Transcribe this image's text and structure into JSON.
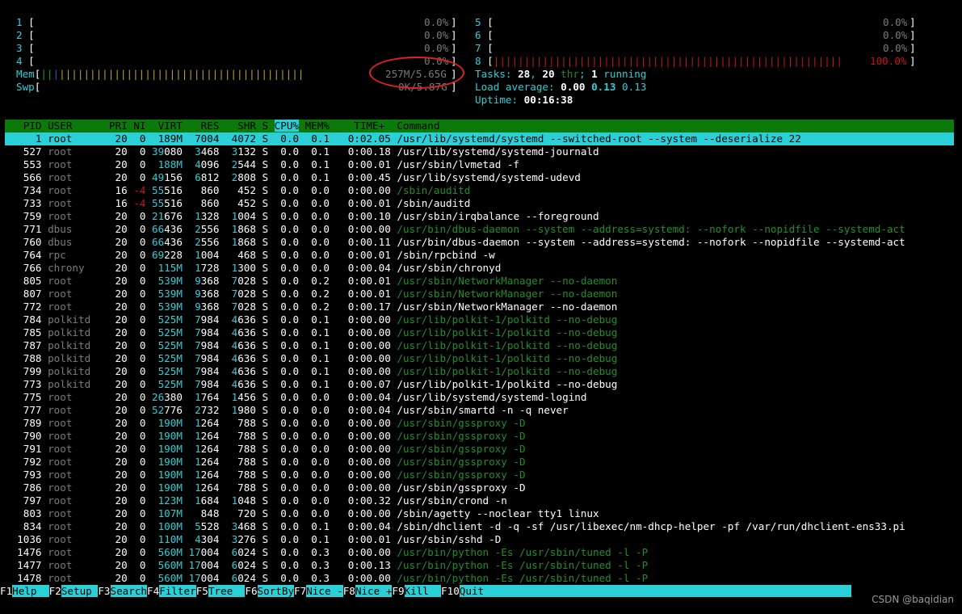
{
  "cpu_left": [
    {
      "num": "1",
      "pct": "0.0%"
    },
    {
      "num": "2",
      "pct": "0.0%"
    },
    {
      "num": "3",
      "pct": "0.0%"
    },
    {
      "num": "4",
      "pct": "0.0%"
    }
  ],
  "cpu_right": [
    {
      "num": "5",
      "pct": "0.0%"
    },
    {
      "num": "6",
      "pct": "0.0%"
    },
    {
      "num": "7",
      "pct": "0.0%"
    },
    {
      "num": "8",
      "pct": "100.0%"
    }
  ],
  "mem": {
    "label": "Mem",
    "value": "257M/5.65G"
  },
  "swp": {
    "label": "Swp",
    "value": "0K/5.87G"
  },
  "tasks": {
    "label": "Tasks: ",
    "tasks": "28",
    "sep": ", ",
    "threads": "20",
    "thr": " thr",
    "sep2": "; ",
    "running": "1",
    "running_label": " running"
  },
  "load": {
    "label": "Load average: ",
    "l1": "0.00",
    "l5": "0.13",
    "l15": "0.13"
  },
  "uptime": {
    "label": "Uptime: ",
    "value": "00:16:38"
  },
  "columns": [
    "PID",
    "USER",
    "PRI",
    "NI",
    "VIRT",
    "RES",
    "SHR",
    "S",
    "CPU%",
    "MEM%",
    "TIME+",
    "Command"
  ],
  "processes": [
    {
      "pid": "1",
      "user": "root",
      "pri": "20",
      "ni": "0",
      "virt": "189M",
      "res": "7004",
      "shr": "4072",
      "s": "S",
      "cpu": "0.0",
      "mem": "0.1",
      "time": "0:02.05",
      "cmd": "/usr/lib/systemd/systemd --switched-root --system --deserialize 22",
      "thread": false,
      "selected": true
    },
    {
      "pid": "527",
      "user": "root",
      "pri": "20",
      "ni": "0",
      "virt": "39080",
      "res": "3468",
      "shr": "3132",
      "s": "S",
      "cpu": "0.0",
      "mem": "0.1",
      "time": "0:00.18",
      "cmd": "/usr/lib/systemd/systemd-journald",
      "thread": false
    },
    {
      "pid": "553",
      "user": "root",
      "pri": "20",
      "ni": "0",
      "virt": "188M",
      "res": "4096",
      "shr": "2544",
      "s": "S",
      "cpu": "0.0",
      "mem": "0.1",
      "time": "0:00.01",
      "cmd": "/usr/sbin/lvmetad -f",
      "thread": false
    },
    {
      "pid": "566",
      "user": "root",
      "pri": "20",
      "ni": "0",
      "virt": "49156",
      "res": "6812",
      "shr": "2808",
      "s": "S",
      "cpu": "0.0",
      "mem": "0.1",
      "time": "0:00.45",
      "cmd": "/usr/lib/systemd/systemd-udevd",
      "thread": false
    },
    {
      "pid": "734",
      "user": "root",
      "pri": "16",
      "ni": "-4",
      "virt": "55516",
      "res": "860",
      "shr": "452",
      "s": "S",
      "cpu": "0.0",
      "mem": "0.0",
      "time": "0:00.00",
      "cmd": "/sbin/auditd",
      "thread": true
    },
    {
      "pid": "733",
      "user": "root",
      "pri": "16",
      "ni": "-4",
      "virt": "55516",
      "res": "860",
      "shr": "452",
      "s": "S",
      "cpu": "0.0",
      "mem": "0.0",
      "time": "0:00.01",
      "cmd": "/sbin/auditd",
      "thread": false
    },
    {
      "pid": "759",
      "user": "root",
      "pri": "20",
      "ni": "0",
      "virt": "21676",
      "res": "1328",
      "shr": "1004",
      "s": "S",
      "cpu": "0.0",
      "mem": "0.0",
      "time": "0:00.10",
      "cmd": "/usr/sbin/irqbalance --foreground",
      "thread": false
    },
    {
      "pid": "771",
      "user": "dbus",
      "pri": "20",
      "ni": "0",
      "virt": "66436",
      "res": "2556",
      "shr": "1868",
      "s": "S",
      "cpu": "0.0",
      "mem": "0.0",
      "time": "0:00.00",
      "cmd": "/usr/bin/dbus-daemon --system --address=systemd: --nofork --nopidfile --systemd-act",
      "thread": true
    },
    {
      "pid": "760",
      "user": "dbus",
      "pri": "20",
      "ni": "0",
      "virt": "66436",
      "res": "2556",
      "shr": "1868",
      "s": "S",
      "cpu": "0.0",
      "mem": "0.0",
      "time": "0:00.11",
      "cmd": "/usr/bin/dbus-daemon --system --address=systemd: --nofork --nopidfile --systemd-act",
      "thread": false
    },
    {
      "pid": "764",
      "user": "rpc",
      "pri": "20",
      "ni": "0",
      "virt": "69228",
      "res": "1004",
      "shr": "468",
      "s": "S",
      "cpu": "0.0",
      "mem": "0.0",
      "time": "0:00.01",
      "cmd": "/sbin/rpcbind -w",
      "thread": false
    },
    {
      "pid": "766",
      "user": "chrony",
      "pri": "20",
      "ni": "0",
      "virt": "115M",
      "res": "1728",
      "shr": "1300",
      "s": "S",
      "cpu": "0.0",
      "mem": "0.0",
      "time": "0:00.04",
      "cmd": "/usr/sbin/chronyd",
      "thread": false
    },
    {
      "pid": "805",
      "user": "root",
      "pri": "20",
      "ni": "0",
      "virt": "539M",
      "res": "9368",
      "shr": "7028",
      "s": "S",
      "cpu": "0.0",
      "mem": "0.2",
      "time": "0:00.01",
      "cmd": "/usr/sbin/NetworkManager --no-daemon",
      "thread": true
    },
    {
      "pid": "807",
      "user": "root",
      "pri": "20",
      "ni": "0",
      "virt": "539M",
      "res": "9368",
      "shr": "7028",
      "s": "S",
      "cpu": "0.0",
      "mem": "0.2",
      "time": "0:00.01",
      "cmd": "/usr/sbin/NetworkManager --no-daemon",
      "thread": true
    },
    {
      "pid": "772",
      "user": "root",
      "pri": "20",
      "ni": "0",
      "virt": "539M",
      "res": "9368",
      "shr": "7028",
      "s": "S",
      "cpu": "0.0",
      "mem": "0.2",
      "time": "0:00.17",
      "cmd": "/usr/sbin/NetworkManager --no-daemon",
      "thread": false
    },
    {
      "pid": "784",
      "user": "polkitd",
      "pri": "20",
      "ni": "0",
      "virt": "525M",
      "res": "7984",
      "shr": "4636",
      "s": "S",
      "cpu": "0.0",
      "mem": "0.1",
      "time": "0:00.00",
      "cmd": "/usr/lib/polkit-1/polkitd --no-debug",
      "thread": true
    },
    {
      "pid": "785",
      "user": "polkitd",
      "pri": "20",
      "ni": "0",
      "virt": "525M",
      "res": "7984",
      "shr": "4636",
      "s": "S",
      "cpu": "0.0",
      "mem": "0.1",
      "time": "0:00.00",
      "cmd": "/usr/lib/polkit-1/polkitd --no-debug",
      "thread": true
    },
    {
      "pid": "787",
      "user": "polkitd",
      "pri": "20",
      "ni": "0",
      "virt": "525M",
      "res": "7984",
      "shr": "4636",
      "s": "S",
      "cpu": "0.0",
      "mem": "0.1",
      "time": "0:00.00",
      "cmd": "/usr/lib/polkit-1/polkitd --no-debug",
      "thread": true
    },
    {
      "pid": "788",
      "user": "polkitd",
      "pri": "20",
      "ni": "0",
      "virt": "525M",
      "res": "7984",
      "shr": "4636",
      "s": "S",
      "cpu": "0.0",
      "mem": "0.1",
      "time": "0:00.00",
      "cmd": "/usr/lib/polkit-1/polkitd --no-debug",
      "thread": true
    },
    {
      "pid": "799",
      "user": "polkitd",
      "pri": "20",
      "ni": "0",
      "virt": "525M",
      "res": "7984",
      "shr": "4636",
      "s": "S",
      "cpu": "0.0",
      "mem": "0.1",
      "time": "0:00.00",
      "cmd": "/usr/lib/polkit-1/polkitd --no-debug",
      "thread": true
    },
    {
      "pid": "773",
      "user": "polkitd",
      "pri": "20",
      "ni": "0",
      "virt": "525M",
      "res": "7984",
      "shr": "4636",
      "s": "S",
      "cpu": "0.0",
      "mem": "0.1",
      "time": "0:00.07",
      "cmd": "/usr/lib/polkit-1/polkitd --no-debug",
      "thread": false
    },
    {
      "pid": "775",
      "user": "root",
      "pri": "20",
      "ni": "0",
      "virt": "26380",
      "res": "1764",
      "shr": "1456",
      "s": "S",
      "cpu": "0.0",
      "mem": "0.0",
      "time": "0:00.04",
      "cmd": "/usr/lib/systemd/systemd-logind",
      "thread": false
    },
    {
      "pid": "777",
      "user": "root",
      "pri": "20",
      "ni": "0",
      "virt": "52776",
      "res": "2732",
      "shr": "1980",
      "s": "S",
      "cpu": "0.0",
      "mem": "0.0",
      "time": "0:00.04",
      "cmd": "/usr/sbin/smartd -n -q never",
      "thread": false
    },
    {
      "pid": "789",
      "user": "root",
      "pri": "20",
      "ni": "0",
      "virt": "190M",
      "res": "1264",
      "shr": "788",
      "s": "S",
      "cpu": "0.0",
      "mem": "0.0",
      "time": "0:00.00",
      "cmd": "/usr/sbin/gssproxy -D",
      "thread": true
    },
    {
      "pid": "790",
      "user": "root",
      "pri": "20",
      "ni": "0",
      "virt": "190M",
      "res": "1264",
      "shr": "788",
      "s": "S",
      "cpu": "0.0",
      "mem": "0.0",
      "time": "0:00.00",
      "cmd": "/usr/sbin/gssproxy -D",
      "thread": true
    },
    {
      "pid": "791",
      "user": "root",
      "pri": "20",
      "ni": "0",
      "virt": "190M",
      "res": "1264",
      "shr": "788",
      "s": "S",
      "cpu": "0.0",
      "mem": "0.0",
      "time": "0:00.00",
      "cmd": "/usr/sbin/gssproxy -D",
      "thread": true
    },
    {
      "pid": "792",
      "user": "root",
      "pri": "20",
      "ni": "0",
      "virt": "190M",
      "res": "1264",
      "shr": "788",
      "s": "S",
      "cpu": "0.0",
      "mem": "0.0",
      "time": "0:00.00",
      "cmd": "/usr/sbin/gssproxy -D",
      "thread": true
    },
    {
      "pid": "793",
      "user": "root",
      "pri": "20",
      "ni": "0",
      "virt": "190M",
      "res": "1264",
      "shr": "788",
      "s": "S",
      "cpu": "0.0",
      "mem": "0.0",
      "time": "0:00.00",
      "cmd": "/usr/sbin/gssproxy -D",
      "thread": true
    },
    {
      "pid": "786",
      "user": "root",
      "pri": "20",
      "ni": "0",
      "virt": "190M",
      "res": "1264",
      "shr": "788",
      "s": "S",
      "cpu": "0.0",
      "mem": "0.0",
      "time": "0:00.00",
      "cmd": "/usr/sbin/gssproxy -D",
      "thread": false
    },
    {
      "pid": "797",
      "user": "root",
      "pri": "20",
      "ni": "0",
      "virt": "123M",
      "res": "1684",
      "shr": "1048",
      "s": "S",
      "cpu": "0.0",
      "mem": "0.0",
      "time": "0:00.32",
      "cmd": "/usr/sbin/crond -n",
      "thread": false
    },
    {
      "pid": "803",
      "user": "root",
      "pri": "20",
      "ni": "0",
      "virt": "107M",
      "res": "848",
      "shr": "720",
      "s": "S",
      "cpu": "0.0",
      "mem": "0.0",
      "time": "0:00.00",
      "cmd": "/sbin/agetty --noclear tty1 linux",
      "thread": false
    },
    {
      "pid": "834",
      "user": "root",
      "pri": "20",
      "ni": "0",
      "virt": "100M",
      "res": "5528",
      "shr": "3468",
      "s": "S",
      "cpu": "0.0",
      "mem": "0.1",
      "time": "0:00.04",
      "cmd": "/sbin/dhclient -d -q -sf /usr/libexec/nm-dhcp-helper -pf /var/run/dhclient-ens33.pi",
      "thread": false
    },
    {
      "pid": "1036",
      "user": "root",
      "pri": "20",
      "ni": "0",
      "virt": "110M",
      "res": "4304",
      "shr": "3276",
      "s": "S",
      "cpu": "0.0",
      "mem": "0.1",
      "time": "0:00.01",
      "cmd": "/usr/sbin/sshd -D",
      "thread": false
    },
    {
      "pid": "1476",
      "user": "root",
      "pri": "20",
      "ni": "0",
      "virt": "560M",
      "res": "17004",
      "shr": "6024",
      "s": "S",
      "cpu": "0.0",
      "mem": "0.3",
      "time": "0:00.00",
      "cmd": "/usr/bin/python -Es /usr/sbin/tuned -l -P",
      "thread": true
    },
    {
      "pid": "1477",
      "user": "root",
      "pri": "20",
      "ni": "0",
      "virt": "560M",
      "res": "17004",
      "shr": "6024",
      "s": "S",
      "cpu": "0.0",
      "mem": "0.3",
      "time": "0:00.13",
      "cmd": "/usr/bin/python -Es /usr/sbin/tuned -l -P",
      "thread": true
    },
    {
      "pid": "1478",
      "user": "root",
      "pri": "20",
      "ni": "0",
      "virt": "560M",
      "res": "17004",
      "shr": "6024",
      "s": "S",
      "cpu": "0.0",
      "mem": "0.3",
      "time": "0:00.00",
      "cmd": "/usr/bin/python -Es /usr/sbin/tuned -l -P",
      "thread": true
    }
  ],
  "footer": [
    {
      "key": "F1",
      "label": "Help  "
    },
    {
      "key": "F2",
      "label": "Setup "
    },
    {
      "key": "F3",
      "label": "Search"
    },
    {
      "key": "F4",
      "label": "Filter"
    },
    {
      "key": "F5",
      "label": "Tree  "
    },
    {
      "key": "F6",
      "label": "SortBy"
    },
    {
      "key": "F7",
      "label": "Nice -"
    },
    {
      "key": "F8",
      "label": "Nice +"
    },
    {
      "key": "F9",
      "label": "Kill  "
    },
    {
      "key": "F10",
      "label": "Quit"
    }
  ],
  "watermark": "CSDN @baqidian",
  "colors": {
    "cyan": "#2ad0d6",
    "header_green": "#0b7a0b",
    "red": "#c81414",
    "annotation": "#dd2222"
  }
}
